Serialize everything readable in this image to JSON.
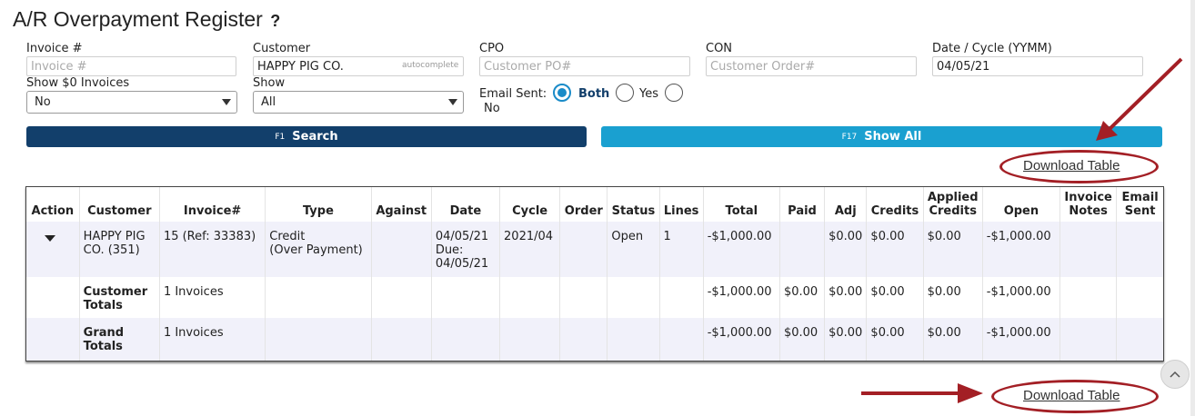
{
  "page": {
    "title": "A/R Overpayment Register",
    "help_icon": "?"
  },
  "filters": {
    "invoice": {
      "label": "Invoice #",
      "placeholder": "Invoice #",
      "value": ""
    },
    "customer": {
      "label": "Customer",
      "value": "HAPPY PIG CO.",
      "hint": "autocomplete"
    },
    "cpo": {
      "label": "CPO",
      "placeholder": "Customer PO#",
      "value": ""
    },
    "con": {
      "label": "CON",
      "placeholder": "Customer Order#",
      "value": ""
    },
    "date_cycle": {
      "label": "Date / Cycle (YYMM)",
      "value": "04/05/21"
    },
    "show_zero": {
      "label": "Show $0 Invoices",
      "selected": "No"
    },
    "show": {
      "label": "Show",
      "selected": "All"
    },
    "email_sent": {
      "label": "Email Sent:",
      "options": [
        "Both",
        "Yes",
        "No"
      ],
      "selected": "Both"
    }
  },
  "buttons": {
    "search": {
      "key": "F1",
      "label": "Search"
    },
    "show_all": {
      "key": "F17",
      "label": "Show All"
    }
  },
  "links": {
    "download_table": "Download Table"
  },
  "table": {
    "columns": [
      "Action",
      "Customer",
      "Invoice#",
      "Type",
      "Against",
      "Date",
      "Cycle",
      "Order",
      "Status",
      "Lines",
      "Total",
      "Paid",
      "Adj",
      "Credits",
      "Applied Credits",
      "Open",
      "Invoice Notes",
      "Email Sent"
    ],
    "invoice_row": {
      "customer": "HAPPY PIG CO. (351)",
      "invoice": "15 (Ref: 33383)",
      "type_line1": "Credit",
      "type_line2": "(Over Payment)",
      "against": "",
      "date": "04/05/21",
      "due": "Due: 04/05/21",
      "cycle": "2021/04",
      "order": "",
      "status": "Open",
      "lines": "1",
      "total": "-$1,000.00",
      "paid": "",
      "adj": "$0.00",
      "credits": "$0.00",
      "applied_credits": "$0.00",
      "open": "-$1,000.00",
      "invoice_notes": "",
      "email_sent": ""
    },
    "customer_totals": {
      "label": "Customer Totals",
      "invoices": "1 Invoices",
      "total": "-$1,000.00",
      "paid": "$0.00",
      "adj": "$0.00",
      "credits": "$0.00",
      "applied_credits": "$0.00",
      "open": "-$1,000.00"
    },
    "grand_totals": {
      "label": "Grand Totals",
      "invoices": "1 Invoices",
      "total": "-$1,000.00",
      "paid": "$0.00",
      "adj": "$0.00",
      "credits": "$0.00",
      "applied_credits": "$0.00",
      "open": "-$1,000.00"
    }
  },
  "colors": {
    "search_button": "#123f6b",
    "show_all_button": "#1aa0d0",
    "radio_accent": "#1a8bc8",
    "annotation": "#a31f25",
    "row_shade": "#f1f1fa"
  }
}
